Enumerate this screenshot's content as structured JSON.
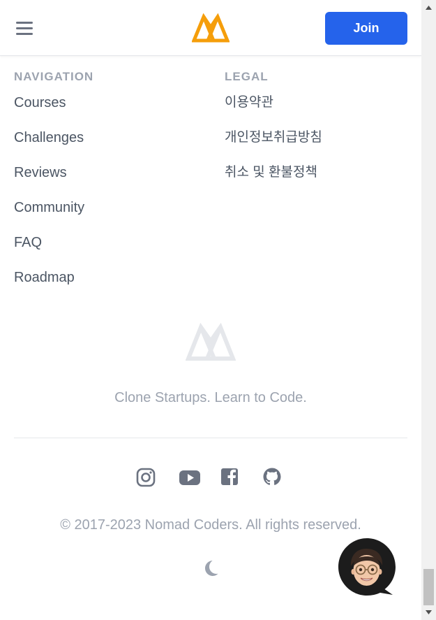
{
  "header": {
    "menu_icon": "hamburger-menu-icon",
    "logo_icon": "nomad-coders-logo",
    "join_label": "Join"
  },
  "footer": {
    "navigation": {
      "title": "NAVIGATION",
      "items": [
        "Courses",
        "Challenges",
        "Reviews",
        "Community",
        "FAQ",
        "Roadmap"
      ]
    },
    "legal": {
      "title": "LEGAL",
      "items": [
        "이용약관",
        "개인정보취급방침",
        "취소 및 환불정책"
      ]
    },
    "tagline": "Clone Startups. Learn to Code.",
    "socials": [
      "instagram-icon",
      "youtube-icon",
      "facebook-icon",
      "github-icon"
    ],
    "copyright": "© 2017-2023 Nomad Coders. All rights reserved.",
    "theme_toggle_icon": "moon-icon"
  },
  "chat": {
    "icon": "chat-avatar"
  },
  "colors": {
    "primary": "#2563eb",
    "logo_orange": "#f59e0b",
    "muted": "#9ca3af",
    "text": "#4b5563",
    "divider": "#e5e7eb"
  }
}
